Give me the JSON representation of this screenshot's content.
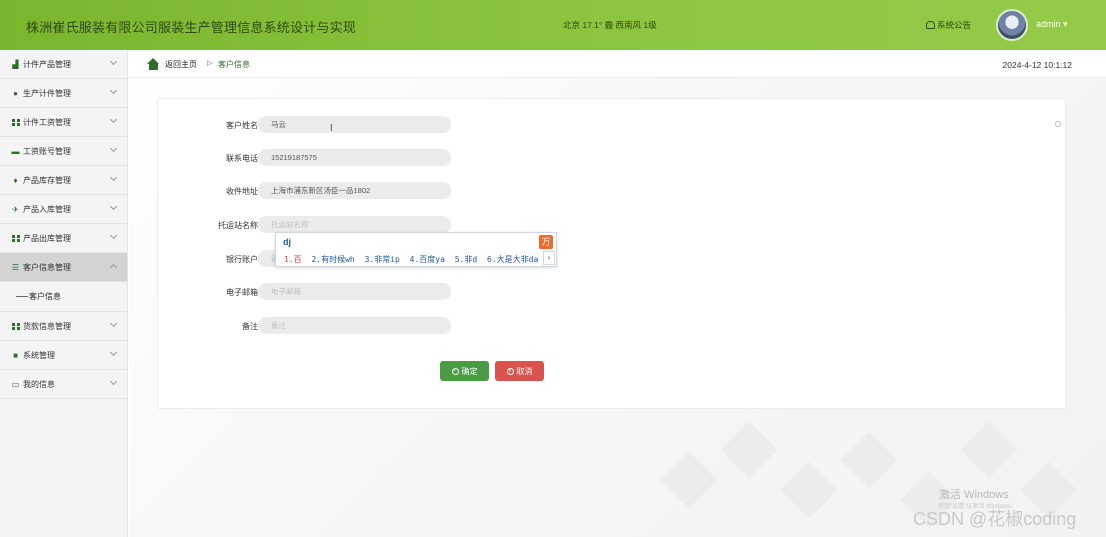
{
  "header": {
    "title": "株洲崔氏服装有限公司服装生产管理信息系统设计与实现",
    "weather": "北京 17.1° 霾 西南风 1级",
    "notice": "系统公告",
    "user": "admin"
  },
  "sidebar": {
    "items": [
      {
        "label": "计件产品管理",
        "icon": "product-icon"
      },
      {
        "label": "生产计件管理",
        "icon": "user-icon"
      },
      {
        "label": "计件工资管理",
        "icon": "grid-icon"
      },
      {
        "label": "工资账号管理",
        "icon": "card-icon"
      },
      {
        "label": "产品库存管理",
        "icon": "leaf-icon"
      },
      {
        "label": "产品入库管理",
        "icon": "plane-icon"
      },
      {
        "label": "产品出库管理",
        "icon": "grid-icon"
      },
      {
        "label": "客户信息管理",
        "icon": "list-icon"
      },
      {
        "label": "货款信息管理",
        "icon": "grid-icon"
      },
      {
        "label": "系统管理",
        "icon": "settings-icon"
      },
      {
        "label": "我的信息",
        "icon": "window-icon"
      }
    ],
    "sub_item": "客户信息"
  },
  "breadcrumb": {
    "home": "返回主页",
    "separator": "▷",
    "current": "客户信息"
  },
  "datetime": "2024-4-12 10:1:12",
  "form": {
    "name_label": "客户姓名",
    "name_value": "马云",
    "phone_label": "联系电话",
    "phone_value": "15219187575",
    "address_label": "收件地址",
    "address_value": "上海市浦东新区汤臣一品1802",
    "station_label": "托运站名称",
    "station_placeholder": "托运站名称",
    "bank_label": "银行账户",
    "bank_placeholder": "银",
    "email_label": "电子邮箱",
    "email_placeholder": "电子邮箱",
    "note_label": "备注",
    "note_placeholder": "备注",
    "ok_label": "确定",
    "cancel_label": "取消"
  },
  "ime": {
    "input": "dj",
    "candidates": [
      "1.百",
      "2.有时候wh",
      "3.非常ip",
      "4.百度ya",
      "5.非d",
      "6.大是大非da"
    ],
    "logo": "万"
  },
  "watermark": {
    "activate": "激活 Windows",
    "activate_hint": "转到\"设置\"以激活 Windows。",
    "csdn": "CSDN @花椒coding"
  },
  "colors": {
    "header_green": "#8cc63f",
    "accent_green": "#2c6e2a",
    "ok_button": "#4a9b43",
    "cancel_button": "#d9534f"
  }
}
